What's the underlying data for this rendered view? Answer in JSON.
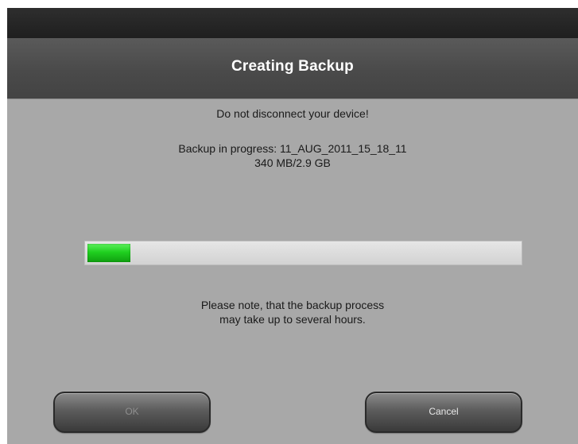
{
  "dialog": {
    "title": "Creating Backup",
    "warning": "Do not disconnect your device!",
    "progress_line": "Backup in progress: 11_AUG_2011_15_18_11",
    "size_line": "340 MB/2.9 GB",
    "progress_fraction": 0.1,
    "progress_color": "#22cc22",
    "note_line1": "Please note, that the backup process",
    "note_line2": "may take up to several hours."
  },
  "buttons": {
    "ok_label": "OK",
    "cancel_label": "Cancel"
  }
}
